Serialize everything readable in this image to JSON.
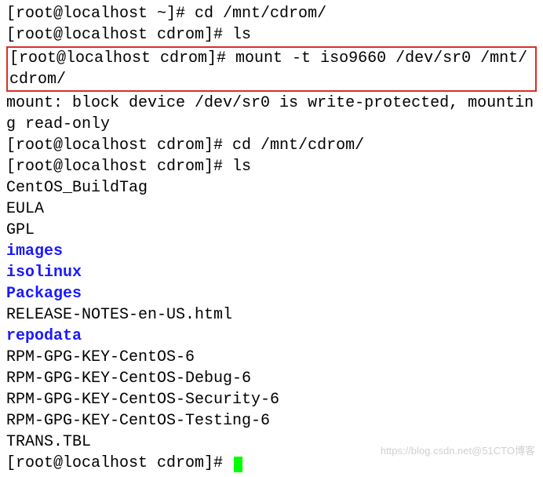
{
  "lines": {
    "l1": "[root@localhost ~]# cd /mnt/cdrom/",
    "l2": "[root@localhost cdrom]# ls",
    "l3": "[root@localhost cdrom]# mount -t iso9660 /dev/sr0 /mnt/cdrom/",
    "l4": "mount: block device /dev/sr0 is write-protected, mounting read-only",
    "l5": "[root@localhost cdrom]# cd /mnt/cdrom/",
    "l6": "[root@localhost cdrom]# ls",
    "l7": "CentOS_BuildTag",
    "l8": "EULA",
    "l9": "GPL",
    "l10": "images",
    "l11": "isolinux",
    "l12": "Packages",
    "l13": "RELEASE-NOTES-en-US.html",
    "l14": "repodata",
    "l15": "RPM-GPG-KEY-CentOS-6",
    "l16": "RPM-GPG-KEY-CentOS-Debug-6",
    "l17": "RPM-GPG-KEY-CentOS-Security-6",
    "l18": "RPM-GPG-KEY-CentOS-Testing-6",
    "l19": "TRANS.TBL",
    "l20": "[root@localhost cdrom]# "
  },
  "watermark": "https://blog.csdn.net@51CTO博客"
}
